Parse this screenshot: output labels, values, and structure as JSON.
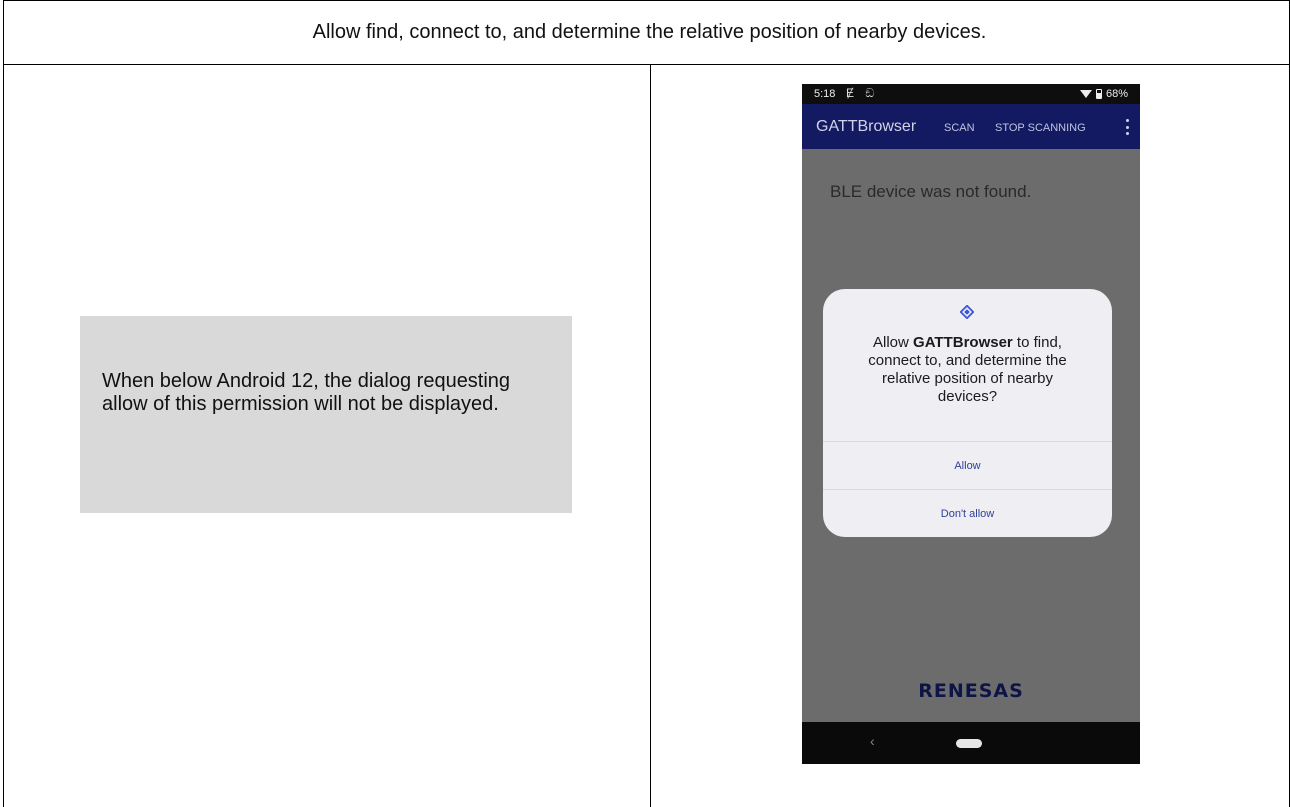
{
  "header": {
    "text": "Allow find, connect to, and determine the relative position of nearby devices."
  },
  "note": {
    "text": "When below Android 12, the dialog requesting allow of this permission will not be displayed."
  },
  "phone": {
    "status": {
      "time": "5:18",
      "left_icons": "Ɇ ඞ",
      "battery": "68%"
    },
    "appbar": {
      "title": "GATTBrowser",
      "scan_label": "SCAN",
      "stop_label": "STOP SCANNING"
    },
    "message": "BLE device was not found.",
    "dialog": {
      "pre": "Allow ",
      "app_name": "GATTBrowser",
      "post": " to find, connect to, and determine the relative position of nearby devices?",
      "allow_label": "Allow",
      "deny_label": "Don't allow"
    },
    "logo": "RENESAS",
    "nav": {
      "back": "‹"
    }
  },
  "colors": {
    "appbar": "#141a62",
    "dialog_button": "#2f3f9a",
    "note_bg": "#d9d9d9"
  }
}
